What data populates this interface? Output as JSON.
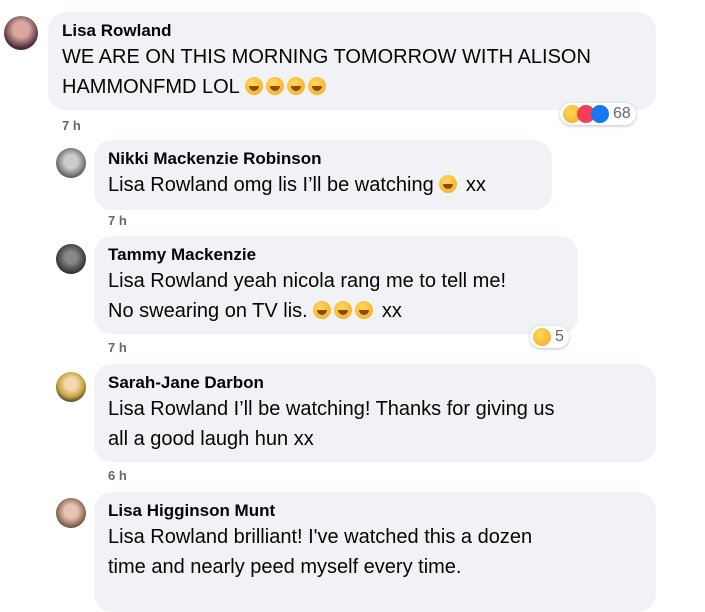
{
  "comments": [
    {
      "name": "Lisa Rowland",
      "text_line1": "WE ARE ON THIS MORNING TOMORROW WITH ALISON",
      "text_line2": "HAMMONFMD LOL",
      "time": "7 h",
      "reaction_count": "68",
      "reaction_icons": [
        "haha-icon",
        "love-icon",
        "like-icon"
      ]
    },
    {
      "name": "Nikki Mackenzie Robinson",
      "mention": "Lisa Rowland",
      "text": " omg lis I’ll be watching",
      "suffix": " xx",
      "time": "7 h"
    },
    {
      "name": "Tammy Mackenzie",
      "mention": "Lisa Rowland",
      "text_line1": " yeah nicola rang me to tell me!",
      "text_line2": "No swearing on TV lis.",
      "suffix": " xx",
      "time": "7 h",
      "reaction_count": "5",
      "reaction_icons": [
        "haha-icon"
      ]
    },
    {
      "name": "Sarah-Jane Darbon",
      "mention": "Lisa Rowland",
      "text_line1": " I’ll be watching! Thanks for giving us",
      "text_line2": "all a good laugh hun xx",
      "time": "6 h"
    },
    {
      "name": "Lisa Higginson Munt",
      "mention": "Lisa Rowland",
      "text_line1": " brilliant! I've watched this a dozen",
      "text_line2": "time and nearly peed myself every time."
    }
  ],
  "colors": {
    "bubble": "#f0f2f5",
    "meta_text": "#65676b",
    "love": "#f33e58",
    "like": "#1877f2"
  }
}
